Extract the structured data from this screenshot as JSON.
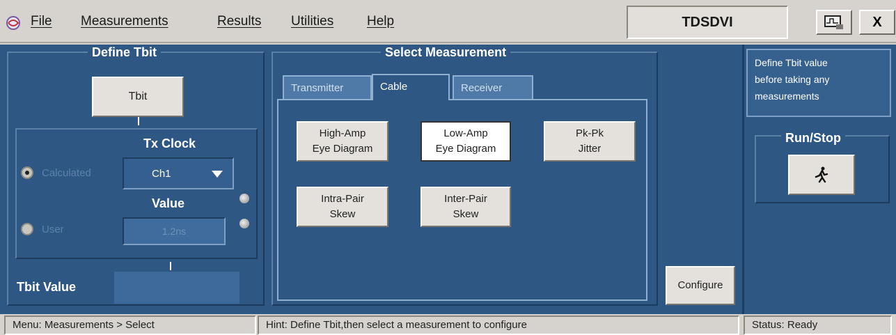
{
  "menu": {
    "items": [
      "File",
      "Measurements",
      "Results",
      "Utilities",
      "Help"
    ],
    "app_title": "TDSDVI",
    "close_label": "X"
  },
  "define_tbit": {
    "title": "Define Tbit",
    "tbit_button": "Tbit",
    "tx_clock_label": "Tx Clock",
    "calculated_label": "Calculated",
    "channel_value": "Ch1",
    "value_label": "Value",
    "user_label": "User",
    "user_value": "1.2ns",
    "tbit_value_label": "Tbit Value",
    "tbit_value": ""
  },
  "select_measurement": {
    "title": "Select Measurement",
    "tabs": [
      "Transmitter",
      "Cable",
      "Receiver"
    ],
    "active_tab": "Cable",
    "buttons": [
      {
        "line1": "High-Amp",
        "line2": "Eye Diagram"
      },
      {
        "line1": "Low-Amp",
        "line2": "Eye Diagram"
      },
      {
        "line1": "Pk-Pk",
        "line2": "Jitter"
      },
      {
        "line1": "Intra-Pair",
        "line2": "Skew"
      },
      {
        "line1": "Inter-Pair",
        "line2": "Skew"
      }
    ],
    "configure_label": "Configure"
  },
  "side": {
    "message": [
      "Define Tbit value",
      "before taking any",
      "measurements"
    ],
    "run_stop_title": "Run/Stop"
  },
  "status": {
    "menu": "Menu: Measurements > Select",
    "hint": "Hint: Define Tbit,then select a measurement to configure",
    "status": "Status: Ready"
  }
}
